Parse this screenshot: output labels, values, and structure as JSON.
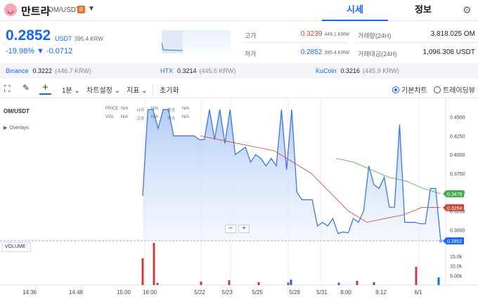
{
  "header": {
    "logo_glyph": "◡",
    "coin_name": "만트라",
    "pair": "OM/USDT",
    "exchange_badge": "B",
    "dropdown_icon": "chevron-down-icon",
    "tabs": [
      {
        "label": "시세",
        "active": true
      },
      {
        "label": "정보",
        "active": false
      }
    ],
    "settings_icon": "gear-icon"
  },
  "price": {
    "value": "0.2852",
    "unit": "USDT",
    "krw": "395.4 KRW",
    "change": "-19.98% ▼ -0.0712"
  },
  "stats": [
    {
      "label": "고가",
      "value": "0.3239",
      "sub": "449.1 KRW",
      "color": "#e03b3b"
    },
    {
      "label": "저가",
      "value": "0.2852",
      "sub": "395.4 KRW",
      "color": "#1764ff"
    },
    {
      "label": "거래량(24H)",
      "value": "3,818.025 OM",
      "sub": ""
    },
    {
      "label": "거래대금(24H)",
      "value": "1,096.308 USDT",
      "sub": ""
    }
  ],
  "exchanges": [
    {
      "name": "Binance",
      "price": "0.3222",
      "krw": "(446.7 KRW)"
    },
    {
      "name": "HTX",
      "price": "0.3214",
      "krw": "(445.6 KRW)"
    },
    {
      "name": "KuCoin",
      "price": "0.3216",
      "krw": "(445.9 KRW)"
    }
  ],
  "toolbar": {
    "interval": "1분 ⌄",
    "chart_settings": "차트설정 ⌄",
    "indicators": "지표 ⌄",
    "reset": "초기화",
    "basic_chart": "기본차트",
    "trading_view": "트레이딩뷰"
  },
  "chart": {
    "symbol": "OM/USDT",
    "overlays": "Overlays",
    "legend": {
      "row1": [
        [
          "PRICE:",
          "N/A"
        ],
        [
          "시가",
          "N/A"
        ],
        [
          "종가",
          "N/A"
        ]
      ],
      "row2": [
        [
          "VOL:",
          "N/A"
        ],
        [
          "고가",
          "N/A"
        ],
        [
          "저가",
          "N/A"
        ]
      ]
    },
    "volume_label": "VOLUME",
    "zoom_out": "−",
    "zoom_in": "+",
    "y_ticks": [
      "0.4500",
      "0.4250",
      "0.4000",
      "0.3750",
      "0.3500",
      "0.3250",
      "0.3000"
    ],
    "vol_ticks": [
      "15.0k",
      "10.0k",
      "5.00k"
    ],
    "x_ticks": [
      "14:36",
      "14:48",
      "15:00",
      "16:00",
      "5/22",
      "5/23",
      "5/25",
      "5/29",
      "5/31",
      "8:00",
      "9:12",
      "6/1"
    ],
    "badges": [
      {
        "value": "0.3479",
        "color": "#3fae49"
      },
      {
        "value": "0.3294",
        "color": "#d0463a"
      },
      {
        "value": "0.2852",
        "color": "#1764ff"
      }
    ],
    "colors": {
      "price_line": "#2f6fe8",
      "ma_red": "#d0463a",
      "ma_green": "#3fae49",
      "vol_up": "#c83c3c",
      "vol_down": "#1764ff"
    }
  },
  "chart_data": {
    "type": "area",
    "title": "",
    "ylim": [
      0.29,
      0.46
    ],
    "x": [
      "16:00",
      "5/22",
      "5/23",
      "5/25",
      "5/29",
      "5/31",
      "8:00",
      "9:12",
      "6/1"
    ],
    "series": [
      {
        "values": [
          0.345,
          0.46,
          0.46,
          0.435,
          0.46,
          0.46,
          0.425,
          0.425,
          0.425,
          0.425,
          0.425,
          0.42,
          0.42,
          0.46,
          0.42,
          0.46,
          0.415,
          0.46,
          0.4,
          0.405,
          0.41,
          0.39,
          0.4,
          0.395,
          0.385,
          0.395,
          0.385,
          0.46,
          0.38,
          0.46,
          0.35,
          0.34,
          0.34,
          0.34,
          0.305,
          0.31,
          0.305,
          0.315,
          0.295,
          0.297,
          0.296,
          0.315,
          0.31,
          0.325,
          0.385,
          0.36,
          0.355,
          0.37,
          0.33,
          0.33,
          0.44,
          0.31,
          0.31,
          0.31,
          0.308,
          0.308,
          0.355,
          0.355,
          0.2852
        ]
      },
      {
        "name": "",
        "values": [
          0.425,
          0.42,
          0.415,
          0.41,
          0.405,
          0.39,
          0.375,
          0.35,
          0.325,
          0.31,
          0.315,
          0.32,
          0.33,
          0.3294
        ]
      },
      {
        "name": "",
        "values": [
          0.395,
          0.39,
          0.38,
          0.37,
          0.365,
          0.355,
          0.3479
        ]
      }
    ],
    "volume": [
      {
        "x": "15:40",
        "value": 14000,
        "up": true
      },
      {
        "x": "16:00",
        "value": 22000,
        "up": true
      },
      {
        "x": "16:10",
        "value": 1200,
        "up": true
      },
      {
        "x": "5/22",
        "value": 1800,
        "up": true
      },
      {
        "x": "5/23",
        "value": 2500,
        "up": true
      },
      {
        "x": "5/25",
        "value": 1500,
        "up": true
      },
      {
        "x": "5/29",
        "value": 1300,
        "up": true
      },
      {
        "x": "5/29",
        "value": 2800,
        "up": false
      },
      {
        "x": "8:00",
        "value": 1200,
        "up": false
      },
      {
        "x": "8:30",
        "value": 2200,
        "up": true
      },
      {
        "x": "9:12",
        "value": 1500,
        "up": false
      },
      {
        "x": "6/1",
        "value": 9500,
        "up": true
      },
      {
        "x": "6/1",
        "value": 4000,
        "up": false
      }
    ]
  }
}
